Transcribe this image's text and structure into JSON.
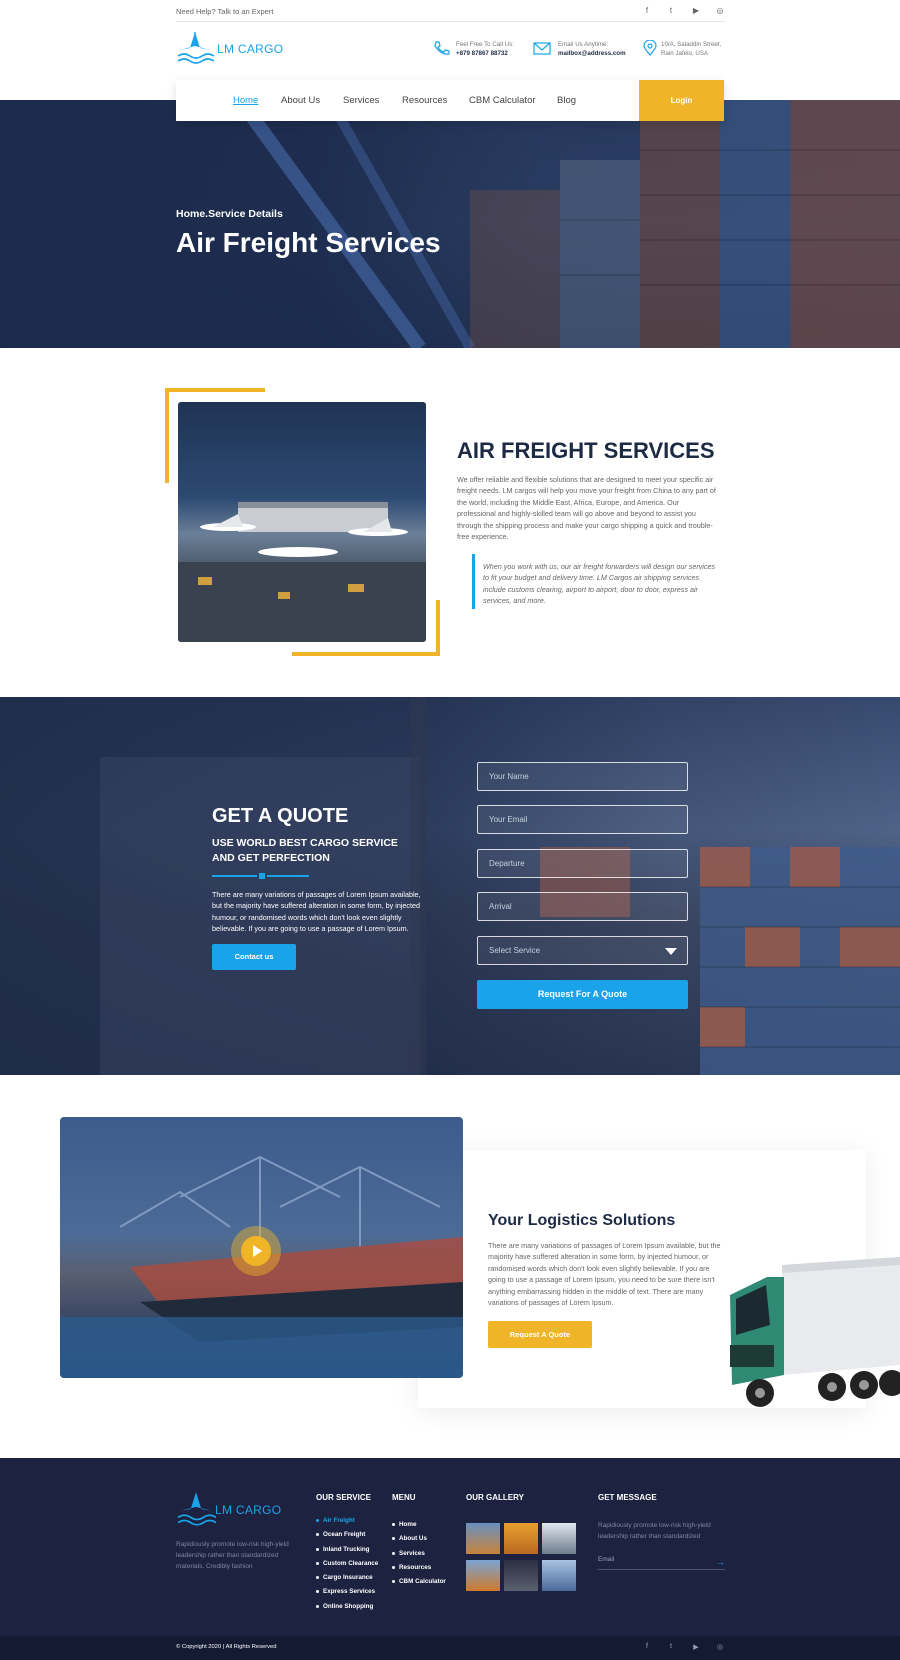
{
  "topbar": {
    "help_text": "Need Help? Talk to an Expert",
    "social": [
      "f",
      "t",
      "▶",
      "◎"
    ]
  },
  "header": {
    "logo_text": "LM CARGO",
    "contacts": [
      {
        "icon": "phone-icon",
        "label": "Feel Free To Call Us:",
        "value": "+879 87867 88732"
      },
      {
        "icon": "mail-icon",
        "label": "Email Us Anytime:",
        "value": "mailbox@address.com"
      },
      {
        "icon": "location-icon",
        "label": "10/A, Saladdin Street,",
        "value": "Rain Jafelo, USA"
      }
    ]
  },
  "nav": {
    "items": [
      "Home",
      "About Us",
      "Services",
      "Resources",
      "CBM Calculator",
      "Blog"
    ],
    "login_label": "Login"
  },
  "hero": {
    "breadcrumb": "Home.Service Details",
    "title": "Air Freight Services"
  },
  "service": {
    "title": "AIR FREIGHT SERVICES",
    "text": "We offer reliable and flexible solutions that are designed to meet your specific air freight needs. LM cargos will help you move your freight from China to any part of the world, including the Middle East, Africa, Europe, and America. Our professional and highly-skilled team will go above and beyond to assist you through the shipping process and make your cargo shipping a quick and trouble-free experience.",
    "quote": "When you work with us, our air freight forwarders will design our services to fit your budget and delivery time. LM Cargos air shipping services include customs clearing, airport to airport, door to door, express air services, and more."
  },
  "quote_section": {
    "title": "GET A QUOTE",
    "subtitle": "USE WORLD BEST CARGO SERVICE AND GET PERFECTION",
    "text": "There are many variations of passages of Lorem Ipsum available, but the majority have suffered alteration in some form, by injected humour, or randomised words which don't look even slightly believable. If you are going to use a passage of Lorem Ipsum.",
    "contact_button": "Contact us",
    "fields": {
      "name_placeholder": "Your Name",
      "email_placeholder": "Your Email",
      "departure_placeholder": "Departure",
      "arrival_placeholder": "Arrival",
      "service_selected": "Select Service"
    },
    "submit_label": "Request For A Quote"
  },
  "logistics": {
    "title": "Your Logistics Solutions",
    "text": "There are many variations of passages of Lorem Ipsum available, but the majority have suffered alteration in some form, by injected humour, or randomised words which don't look even slightly believable. If you are going to use a passage of Lorem Ipsum, you need to be sure there isn't anything embarrassing hidden in the middle of text. There are many variations of passages of Lorem Ipsum.",
    "button": "Request A Quote"
  },
  "footer": {
    "logo_text": "LM CARGO",
    "description": "Rapidiously promote low-risk high-yield leadership rather than standardized materials. Credibly fashion",
    "service_heading": "OUR SERVICE",
    "services": [
      "Air Freight",
      "Ocean Freight",
      "Inland Trucking",
      "Custom Clearance",
      "Cargo Insurance",
      "Express Services",
      "Online Shopping"
    ],
    "menu_heading": "MENU",
    "menu": [
      "Home",
      "About Us",
      "Services",
      "Resources",
      "CBM Calculator"
    ],
    "gallery_heading": "OUR GALLERY",
    "message_heading": "GET MESSAGE",
    "message_text": "Rapidiously promote low-risk high-yield leadership rather than standardized",
    "email_placeholder": "Email",
    "copyright": "© Copyright 2020 | All Rights Reserved",
    "social": [
      "f",
      "t",
      "▶",
      "◎"
    ]
  },
  "colors": {
    "accent": "#1aa3e8",
    "yellow": "#f0b429",
    "navy": "#1d2a44",
    "footer": "#1d2240"
  }
}
